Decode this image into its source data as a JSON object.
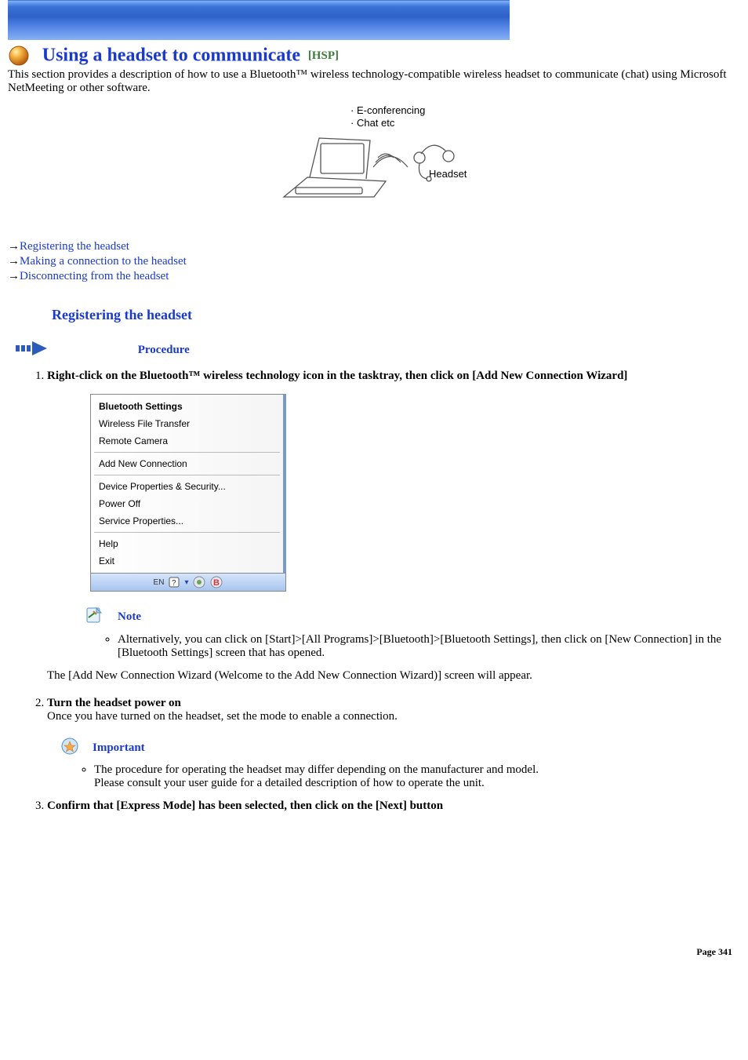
{
  "title": {
    "main": "Using a headset to communicate",
    "tag": "[HSP]"
  },
  "intro": "This section provides a description of how to use a Bluetooth™ wireless technology-compatible wireless headset to communicate (chat) using Microsoft NetMeeting or other software.",
  "diagram": {
    "label_top1": "E-conferencing",
    "label_top2": "Chat etc",
    "label_right": "Headset"
  },
  "links": {
    "l1": "Registering the headset",
    "l2": "Making a connection to the headset",
    "l3": "Disconnecting from the headset"
  },
  "section1": {
    "heading": "Registering the headset",
    "procedure_label": "Procedure",
    "step1": {
      "title": "Right-click on the Bluetooth™ wireless technology icon in the tasktray, then click on [Add New Connection Wizard]",
      "menu": {
        "m1": "Bluetooth Settings",
        "m2": "Wireless File Transfer",
        "m3": "Remote Camera",
        "m4": "Add New Connection",
        "m5": "Device Properties & Security...",
        "m6": "Power Off",
        "m7": "Service Properties...",
        "m8": "Help",
        "m9": "Exit",
        "tray": "EN"
      },
      "note_label": "Note",
      "note_text": "Alternatively, you can click on [Start]>[All Programs]>[Bluetooth]>[Bluetooth Settings], then click on [New Connection] in the [Bluetooth Settings] screen that has opened.",
      "continuation": "The [Add New Connection Wizard (Welcome to the Add New Connection Wizard)] screen will appear."
    },
    "step2": {
      "title": "Turn the headset power on",
      "body": "Once you have turned on the headset, set the mode to enable a connection.",
      "important_label": "Important",
      "imp_text1": "The procedure for operating the headset may differ depending on the manufacturer and model.",
      "imp_text2": "Please consult your user guide for a detailed description of how to operate the unit."
    },
    "step3": {
      "title": "Confirm that [Express Mode] has been selected, then click on the [Next] button"
    }
  },
  "page_number": "Page 341"
}
